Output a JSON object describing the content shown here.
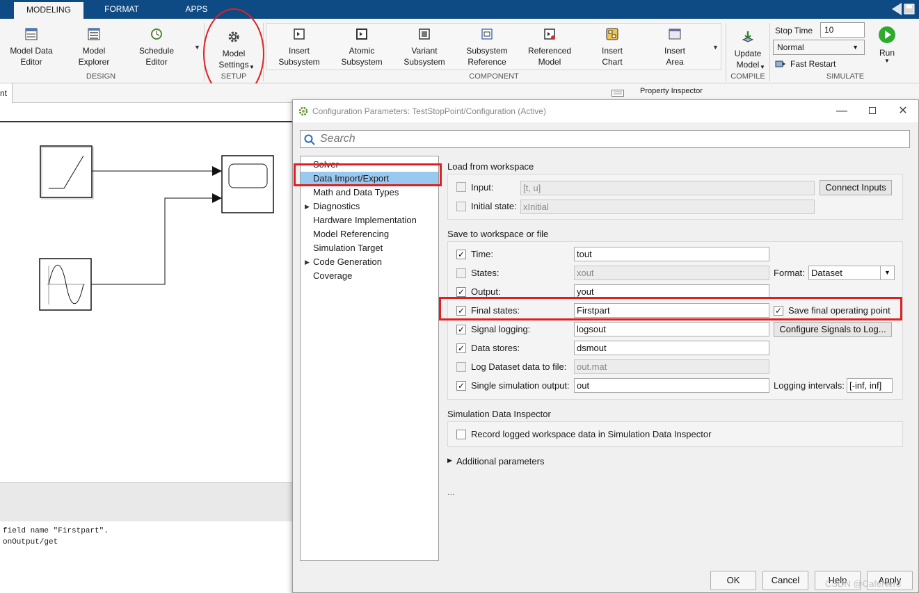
{
  "ribbon_tabs": [
    "MODELING",
    "FORMAT",
    "APPS"
  ],
  "design_group": {
    "label": "DESIGN",
    "buttons": [
      "Model Data\nEditor",
      "Model\nExplorer",
      "Schedule\nEditor"
    ]
  },
  "setup_group": {
    "label": "SETUP",
    "button": "Model\nSettings"
  },
  "component_group": {
    "label": "COMPONENT",
    "buttons": [
      "Insert\nSubsystem",
      "Atomic\nSubsystem",
      "Variant\nSubsystem",
      "Subsystem\nReference",
      "Referenced\nModel",
      "Insert\nChart",
      "Insert\nArea"
    ]
  },
  "compile_group": {
    "label": "COMPILE",
    "button": "Update\nModel"
  },
  "simulate_group": {
    "label": "SIMULATE",
    "stop_time_label": "Stop Time",
    "stop_time_value": "10",
    "mode_value": "Normal",
    "fast_restart_label": "Fast Restart",
    "run_label": "Run"
  },
  "canvas": {
    "tab_fragment": "nt",
    "property_inspector": "Property Inspector"
  },
  "command_window": {
    "lines": [
      "field name \"Firstpart\".",
      "onOutput/get"
    ]
  },
  "dialog": {
    "title": "Configuration Parameters: TestStopPoint/Configuration (Active)",
    "search_placeholder": "Search",
    "nav": [
      {
        "label": "Solver",
        "expandable": false,
        "selected": false
      },
      {
        "label": "Data Import/Export",
        "expandable": false,
        "selected": true
      },
      {
        "label": "Math and Data Types",
        "expandable": false,
        "selected": false
      },
      {
        "label": "Diagnostics",
        "expandable": true,
        "selected": false
      },
      {
        "label": "Hardware Implementation",
        "expandable": false,
        "selected": false
      },
      {
        "label": "Model Referencing",
        "expandable": false,
        "selected": false
      },
      {
        "label": "Simulation Target",
        "expandable": false,
        "selected": false
      },
      {
        "label": "Code Generation",
        "expandable": true,
        "selected": false
      },
      {
        "label": "Coverage",
        "expandable": false,
        "selected": false
      }
    ],
    "load_section": {
      "title": "Load from workspace",
      "input_label": "Input:",
      "input_value": "[t, u]",
      "connect_inputs": "Connect Inputs",
      "initial_state_label": "Initial state:",
      "initial_state_value": "xInitial"
    },
    "save_section": {
      "title": "Save to workspace or file",
      "time_label": "Time:",
      "time_value": "tout",
      "states_label": "States:",
      "states_value": "xout",
      "format_label": "Format:",
      "format_value": "Dataset",
      "output_label": "Output:",
      "output_value": "yout",
      "final_states_label": "Final states:",
      "final_states_value": "Firstpart",
      "save_final_op_label": "Save final operating point",
      "signal_logging_label": "Signal logging:",
      "signal_logging_value": "logsout",
      "configure_signals": "Configure Signals to Log...",
      "data_stores_label": "Data stores:",
      "data_stores_value": "dsmout",
      "log_dataset_label": "Log Dataset data to file:",
      "log_dataset_value": "out.mat",
      "single_output_label": "Single simulation output:",
      "single_output_value": "out",
      "logging_intervals_label": "Logging intervals:",
      "logging_intervals_value": "[-inf, inf]"
    },
    "sdi_section": {
      "title": "Simulation Data Inspector",
      "record_label": "Record logged workspace data in Simulation Data Inspector"
    },
    "additional_parameters": "Additional parameters",
    "ellipsis": "...",
    "footer": {
      "ok": "OK",
      "cancel": "Cancel",
      "help": "Help",
      "apply": "Apply"
    },
    "watermark": "CSDN @CafeNerd"
  },
  "colors": {
    "ribbon_bar": "#0e4a84",
    "selection": "#99c9ef",
    "annotation_red": "#e02020",
    "run_green": "#2eaa2e"
  }
}
